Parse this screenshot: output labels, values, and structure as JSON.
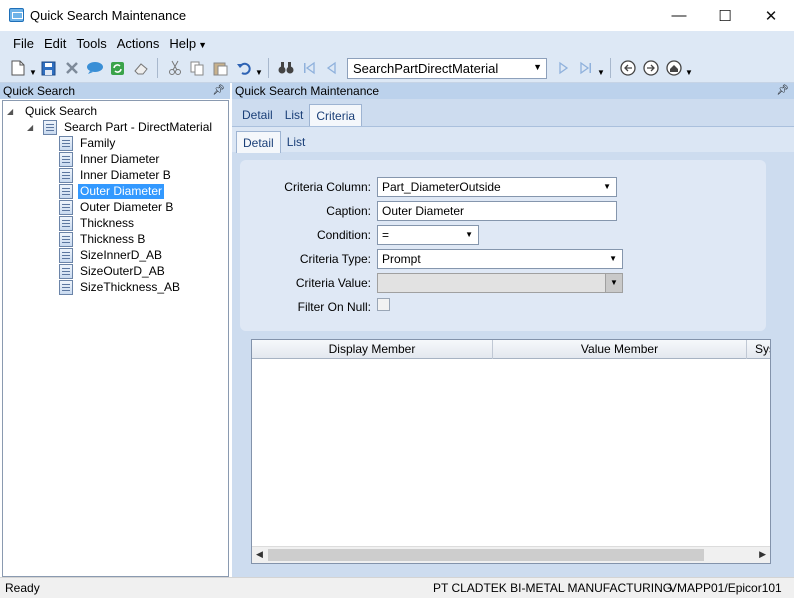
{
  "window": {
    "title": "Quick Search Maintenance",
    "minimize": "—",
    "maximize": "☐",
    "close": "✕"
  },
  "menu": [
    "File",
    "Edit",
    "Tools",
    "Actions",
    "Help"
  ],
  "toolbar": {
    "search_combo_value": "SearchPartDirectMaterial"
  },
  "left_panel": {
    "header": "Quick Search",
    "tree": {
      "root": "Quick Search",
      "search": "Search Part - DirectMaterial",
      "items": [
        "Family",
        "Inner Diameter",
        "Inner Diameter B",
        "Outer Diameter",
        "Outer Diameter B",
        "Thickness",
        "Thickness B",
        "SizeInnerD_AB",
        "SizeOuterD_AB",
        "SizeThickness_AB"
      ],
      "selected": "Outer Diameter"
    }
  },
  "right_panel": {
    "header": "Quick Search Maintenance",
    "tabs": [
      "Detail",
      "List",
      "Criteria"
    ],
    "active_tab": "Criteria",
    "subtabs": [
      "Detail",
      "List"
    ],
    "active_subtab": "Detail",
    "form": {
      "criteria_column_label": "Criteria Column:",
      "criteria_column_value": "Part_DiameterOutside",
      "caption_label": "Caption:",
      "caption_value": "Outer Diameter",
      "condition_label": "Condition:",
      "condition_value": "=",
      "criteria_type_label": "Criteria Type:",
      "criteria_type_value": "Prompt",
      "criteria_value_label": "Criteria Value:",
      "criteria_value_value": "",
      "filter_on_null_label": "Filter On Null:",
      "filter_on_null_checked": false
    },
    "grid": {
      "columns": [
        "Display Member",
        "Value Member",
        "Sys"
      ],
      "rows": []
    }
  },
  "status": {
    "left": "Ready",
    "company": "PT CLADTEK BI-METAL MANUFACTURING",
    "server": "VMAPP01/Epicor101"
  },
  "colors": {
    "selection": "#3399ff",
    "panel_header": "#bcd2ec",
    "chrome": "#dde8f5"
  }
}
